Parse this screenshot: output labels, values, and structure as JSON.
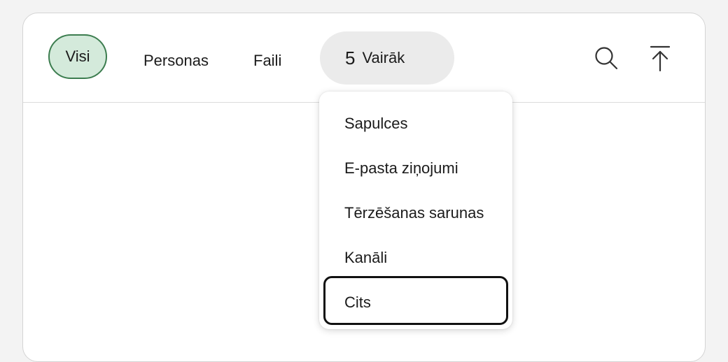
{
  "tabs": {
    "all": "Visi",
    "people": "Personas",
    "files": "Faili",
    "more_count": "5",
    "more_label": "Vairāk"
  },
  "icons": {
    "search": "search-icon",
    "scroll_top": "arrow-up-to-top-icon"
  },
  "menu": {
    "items": [
      "Sapulces",
      "E-pasta ziņojumi",
      "Tērzēšanas sarunas",
      "Kanāli",
      "Cits"
    ],
    "focused_index": 4
  },
  "colors": {
    "accent_fill": "#d4eadb",
    "accent_border": "#3c7d4f",
    "more_bg": "#ebebeb"
  }
}
